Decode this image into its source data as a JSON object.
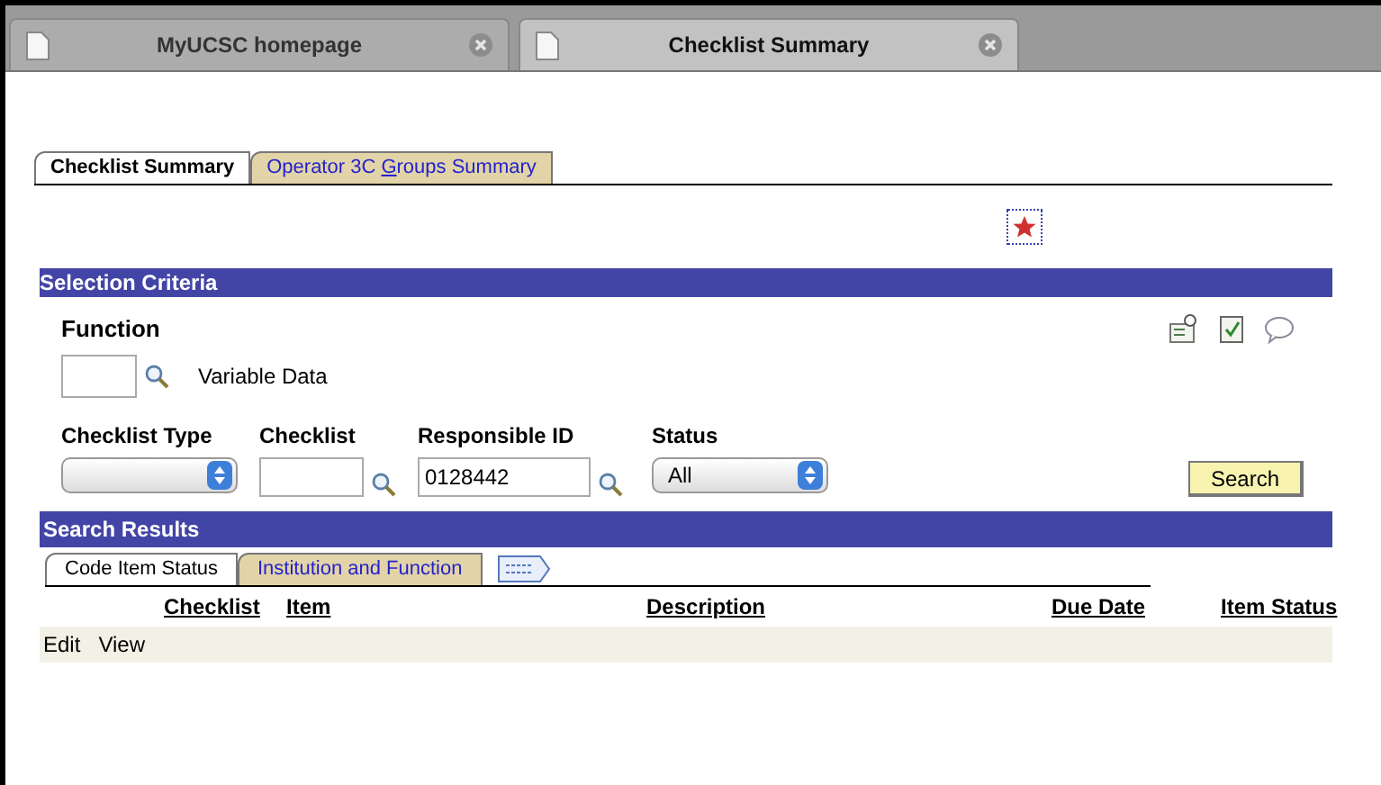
{
  "browser_tabs": [
    {
      "title": "MyUCSC homepage",
      "selected": false
    },
    {
      "title": "Checklist Summary",
      "selected": true
    }
  ],
  "page_tabs": [
    {
      "label": "Checklist Summary",
      "selected": true
    },
    {
      "label": "Operator 3C **G**roups Summary",
      "selected": false
    }
  ],
  "selection_criteria": {
    "title": "Selection Criteria",
    "function_label": "Function",
    "variable_data": "Variable Data",
    "fields": [
      {
        "kind": "select",
        "label": "Checklist Type"
      },
      {
        "kind": "lookup",
        "label": "Checklist"
      },
      {
        "kind": "lookup",
        "label": "Responsible ID",
        "value": "0128442"
      },
      {
        "kind": "select",
        "label": "Status",
        "value": "All"
      }
    ],
    "search_button": "Search"
  },
  "search_results": {
    "title": "Search Results",
    "tabs": [
      {
        "label": "Code Item Status",
        "selected": true
      },
      {
        "label": "Institution and Function",
        "selected": false
      }
    ],
    "columns": [
      "Checklist",
      "Item",
      "Description",
      "Due Date",
      "Item Status"
    ],
    "row_actions": [
      "Edit",
      "View"
    ]
  }
}
